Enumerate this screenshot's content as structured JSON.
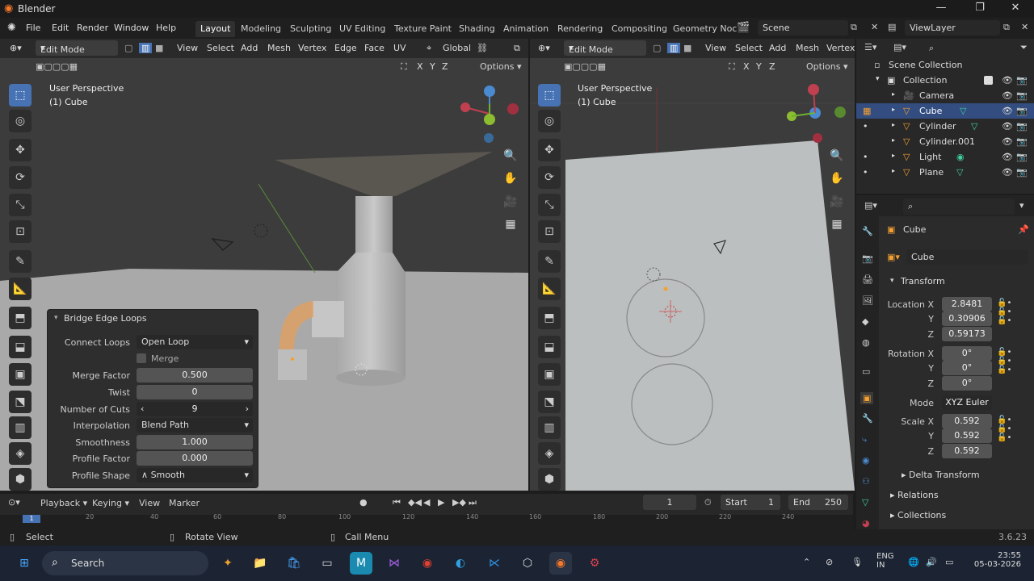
{
  "app": {
    "title": "Blender",
    "version": "3.6.23"
  },
  "menu": [
    "File",
    "Edit",
    "Render",
    "Window",
    "Help"
  ],
  "workspaces": [
    "Layout",
    "Modeling",
    "Sculpting",
    "UV Editing",
    "Texture Paint",
    "Shading",
    "Animation",
    "Rendering",
    "Compositing",
    "Geometry Noc"
  ],
  "scene": "Scene",
  "view_layer": "ViewLayer",
  "left_view": {
    "mode": "Edit Mode",
    "menus": [
      "View",
      "Select",
      "Add",
      "Mesh",
      "Vertex",
      "Edge",
      "Face",
      "UV"
    ],
    "orientation": "Global",
    "options": "Options",
    "perspective": "User Perspective",
    "object": "(1) Cube",
    "axes": [
      "X",
      "Y",
      "Z"
    ]
  },
  "right_view": {
    "mode": "Edit Mode",
    "menus": [
      "View",
      "Select",
      "Add",
      "Mesh",
      "Vertex"
    ],
    "options": "Options",
    "perspective": "User Perspective",
    "object": "(1) Cube",
    "axes": [
      "X",
      "Y",
      "Z"
    ]
  },
  "operator": {
    "title": "Bridge Edge Loops",
    "connect_label": "Connect Loops",
    "connect_value": "Open Loop",
    "merge": "Merge",
    "merge_factor_label": "Merge Factor",
    "merge_factor": "0.500",
    "twist_label": "Twist",
    "twist": "0",
    "cuts_label": "Number of Cuts",
    "cuts": "9",
    "interp_label": "Interpolation",
    "interp": "Blend Path",
    "smooth_label": "Smoothness",
    "smooth": "1.000",
    "profile_factor_label": "Profile Factor",
    "profile_factor": "0.000",
    "profile_shape_label": "Profile Shape",
    "profile_shape": "Smooth"
  },
  "outliner": {
    "root": "Scene Collection",
    "collection": "Collection",
    "items": [
      "Camera",
      "Cube",
      "Cylinder",
      "Cylinder.001",
      "Light",
      "Plane"
    ]
  },
  "properties": {
    "object": "Cube",
    "data_name": "Cube",
    "transform": "Transform",
    "loc_label": "Location X",
    "loc": [
      "2.8481",
      "0.30906",
      "0.59173"
    ],
    "rot_label": "Rotation X",
    "rot": [
      "0°",
      "0°",
      "0°"
    ],
    "mode_label": "Mode",
    "mode": "XYZ Euler",
    "scale_label": "Scale X",
    "scale": [
      "0.592",
      "0.592",
      "0.592"
    ],
    "y": "Y",
    "z": "Z",
    "delta": "Delta Transform",
    "relations": "Relations",
    "collections": "Collections"
  },
  "timeline": {
    "menus": [
      "Playback",
      "Keying",
      "View",
      "Marker"
    ],
    "frame": "1",
    "start_label": "Start",
    "start": "1",
    "end_label": "End",
    "end": "250",
    "ticks": [
      "1",
      "20",
      "40",
      "60",
      "80",
      "100",
      "120",
      "140",
      "160",
      "180",
      "200",
      "220",
      "240"
    ]
  },
  "status": {
    "select": "Select",
    "rotate": "Rotate View",
    "call_menu": "Call Menu"
  },
  "taskbar": {
    "search": "Search",
    "lang": "ENG",
    "region": "IN",
    "time": "23:55",
    "date": "05-03-2026"
  }
}
